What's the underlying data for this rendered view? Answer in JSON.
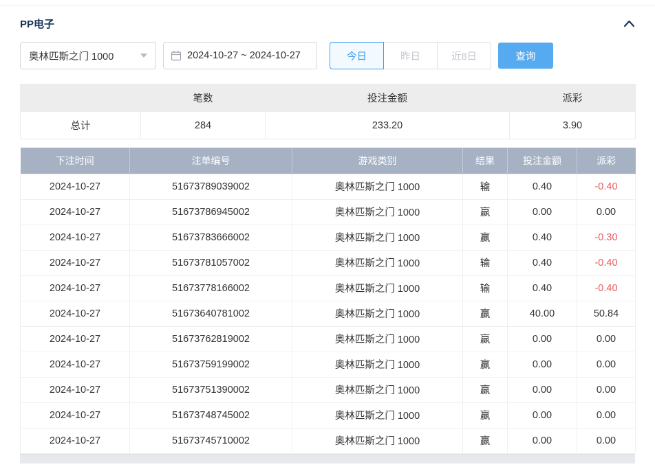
{
  "header": {
    "title": "PP电子"
  },
  "filters": {
    "game_select_value": "奥林匹斯之门 1000",
    "date_range_value": "2024-10-27 ~ 2024-10-27",
    "quick_buttons": [
      {
        "label": "今日",
        "active": true
      },
      {
        "label": "昨日",
        "active": false
      },
      {
        "label": "近8日",
        "active": false
      }
    ],
    "query_label": "查询"
  },
  "summary": {
    "headers": [
      "",
      "笔数",
      "投注金额",
      "派彩"
    ],
    "total": {
      "label": "总计",
      "count": "284",
      "bet_amount": "233.20",
      "payout": "3.90"
    }
  },
  "table": {
    "headers": [
      "下注时间",
      "注单编号",
      "游戏类别",
      "结果",
      "投注金额",
      "派彩"
    ],
    "rows": [
      [
        "2024-10-27",
        "51673789039002",
        "奥林匹斯之门 1000",
        "输",
        "0.40",
        "-0.40"
      ],
      [
        "2024-10-27",
        "51673786945002",
        "奥林匹斯之门 1000",
        "赢",
        "0.00",
        "0.00"
      ],
      [
        "2024-10-27",
        "51673783666002",
        "奥林匹斯之门 1000",
        "赢",
        "0.40",
        "-0.30"
      ],
      [
        "2024-10-27",
        "51673781057002",
        "奥林匹斯之门 1000",
        "输",
        "0.40",
        "-0.40"
      ],
      [
        "2024-10-27",
        "51673778166002",
        "奥林匹斯之门 1000",
        "输",
        "0.40",
        "-0.40"
      ],
      [
        "2024-10-27",
        "51673640781002",
        "奥林匹斯之门 1000",
        "赢",
        "40.00",
        "50.84"
      ],
      [
        "2024-10-27",
        "51673762819002",
        "奥林匹斯之门 1000",
        "赢",
        "0.00",
        "0.00"
      ],
      [
        "2024-10-27",
        "51673759199002",
        "奥林匹斯之门 1000",
        "赢",
        "0.00",
        "0.00"
      ],
      [
        "2024-10-27",
        "51673751390002",
        "奥林匹斯之门 1000",
        "赢",
        "0.00",
        "0.00"
      ],
      [
        "2024-10-27",
        "51673748745002",
        "奥林匹斯之门 1000",
        "赢",
        "0.00",
        "0.00"
      ],
      [
        "2024-10-27",
        "51673745710002",
        "奥林匹斯之门 1000",
        "赢",
        "0.00",
        "0.00"
      ]
    ]
  },
  "colors": {
    "accent_blue": "#3d9af0",
    "query_button_blue": "#55aaf0",
    "table_header_bg": "#a6b2c4",
    "negative_red": "#e65c5c",
    "title_navy": "#17325a",
    "summary_header_bg": "#ededed"
  }
}
